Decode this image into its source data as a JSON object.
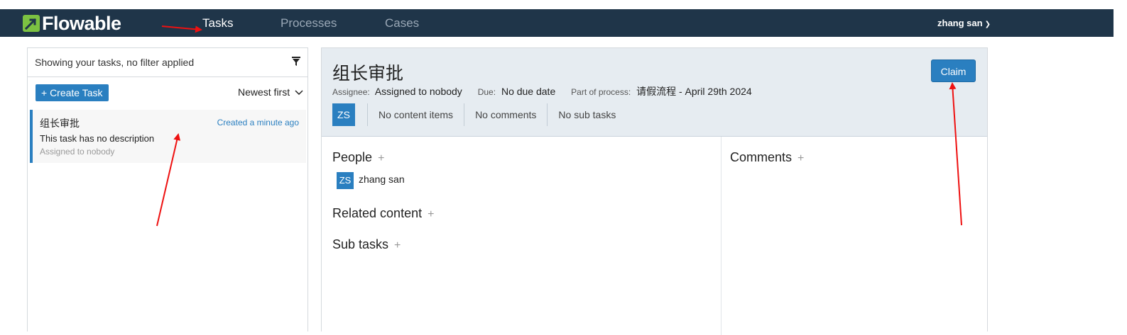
{
  "brand": {
    "name": "Flowable",
    "accent": "#7cc242",
    "nav_bg": "#1f3549",
    "primary": "#2a7fc0"
  },
  "nav": {
    "items": [
      {
        "label": "Tasks",
        "active": true
      },
      {
        "label": "Processes",
        "active": false
      },
      {
        "label": "Cases",
        "active": false
      }
    ],
    "user": "zhang san"
  },
  "task_list": {
    "filter_text": "Showing your tasks, no filter applied",
    "create_label": "+ Create Task",
    "sort_label": "Newest first",
    "tasks": [
      {
        "title": "组长审批",
        "created": "Created a minute ago",
        "description": "This task has no description",
        "assignee": "Assigned to nobody"
      }
    ]
  },
  "task_detail": {
    "title": "组长审批",
    "claim_label": "Claim",
    "assignee_label": "Assignee:",
    "assignee_value": "Assigned to nobody",
    "due_label": "Due:",
    "due_value": "No due date",
    "process_label": "Part of process:",
    "process_value": "请假流程 - April 29th 2024",
    "avatar_initials": "ZS",
    "stats": {
      "content": "No content items",
      "comments": "No comments",
      "subtasks": "No sub tasks"
    },
    "sections": {
      "people": "People",
      "related": "Related content",
      "subtasks": "Sub tasks",
      "comments": "Comments"
    },
    "people": [
      {
        "initials": "ZS",
        "name": "zhang san"
      }
    ]
  }
}
